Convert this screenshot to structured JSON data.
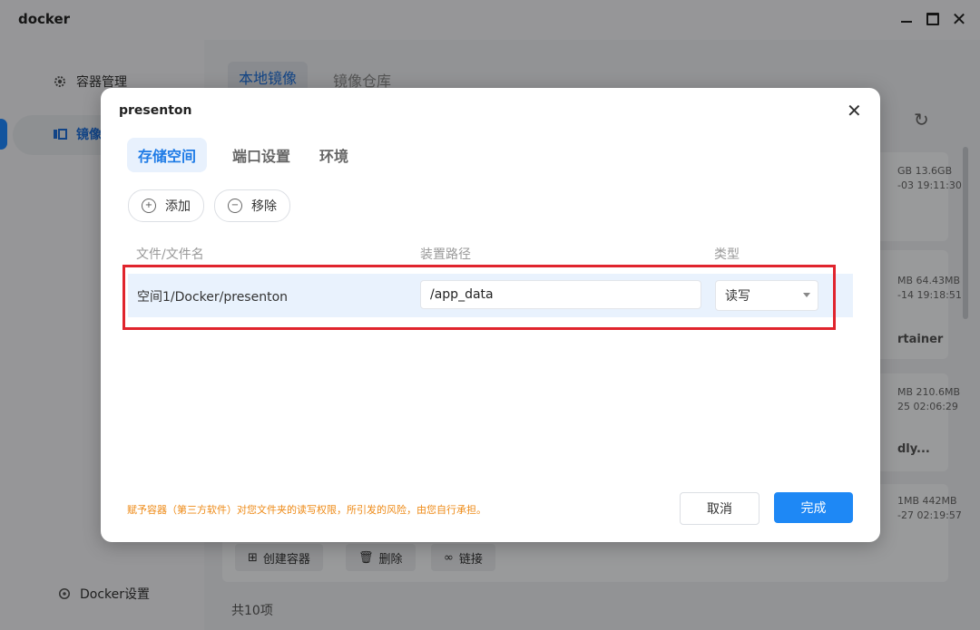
{
  "app": {
    "title": "docker"
  },
  "sidebar": {
    "items": [
      {
        "label": "容器管理",
        "icon": "gear-icon"
      },
      {
        "label": "镜像",
        "icon": "image-icon"
      }
    ],
    "footer_label": "Docker设置"
  },
  "main": {
    "tabs": [
      {
        "label": "本地镜像"
      },
      {
        "label": "镜像仓库"
      }
    ],
    "cards": [
      {
        "meta1": "GB 13.6GB",
        "meta2": "-03 19:11:30",
        "name": ""
      },
      {
        "meta1": "MB 64.43MB",
        "meta2": "-14 19:18:51",
        "name": "rtainer"
      },
      {
        "meta1": "MB 210.6MB",
        "meta2": "25 02:06:29",
        "name": "dly..."
      },
      {
        "meta1": "1MB 442MB",
        "meta2": "-27 02:19:57",
        "name": ""
      }
    ],
    "actions": {
      "create": "创建容器",
      "delete": "删除",
      "link": "链接"
    },
    "total": "共10项"
  },
  "dialog": {
    "title": "presenton",
    "tabs": [
      {
        "label": "存储空间"
      },
      {
        "label": "端口设置"
      },
      {
        "label": "环境"
      }
    ],
    "add_label": "添加",
    "remove_label": "移除",
    "columns": {
      "file": "文件/文件名",
      "mount": "装置路径",
      "type": "类型"
    },
    "row": {
      "path": "空间1/Docker/presenton",
      "mount": "/app_data",
      "type": "读写"
    },
    "warning": "赋予容器（第三方软件）对您文件夹的读写权限，所引发的风险，由您自行承担。",
    "cancel_label": "取消",
    "ok_label": "完成"
  },
  "colors": {
    "accent": "#1e88f5",
    "highlight": "#e0242d",
    "warning": "#ee8a16"
  }
}
